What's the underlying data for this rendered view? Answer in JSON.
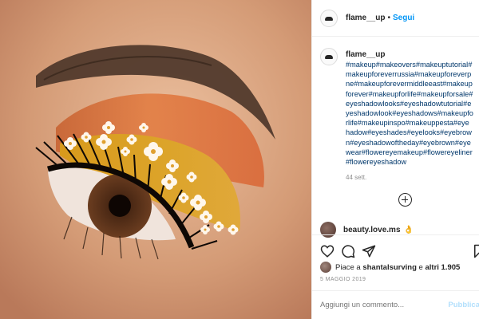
{
  "post": {
    "username": "flame__up",
    "separator": "•",
    "follow_label": "Segui"
  },
  "caption": {
    "username": "flame__up",
    "hashtag_lines": [
      "#makeup#makeovers#makeuptutorial#",
      "makeupforeverrussia#makeupforeverp",
      "ne#makeupforevermiddleeast#makeup",
      "forever#makeupforlife#makeupforsale#",
      "eyeshadowlooks#eyeshadowtutorial#e",
      "yeshadowlook#eyeshadows#makeupfo",
      "rlife#makeupinspo#makeuppesta#eye",
      "hadow#eyeshades#eyelooks#eyebrow",
      "n#eyeshadowoftheday#eyebrown#eye",
      "wear#flowereyemakeup#flowereyeliner",
      "#flowereyeshadow"
    ],
    "time_ago": "44 sett."
  },
  "comment": {
    "username": "beauty.love.ms",
    "emoji": "👌"
  },
  "likes": {
    "prefix": "Piace a",
    "user": "shantalsurving",
    "middle": "e",
    "others": "altri 1.905"
  },
  "date": "5 MAGGIO 2019",
  "comment_input": {
    "placeholder": "Aggiungi un commento..."
  },
  "publish_label": "Pubblica",
  "icons": [
    "heart-icon",
    "comment-icon",
    "share-icon",
    "bookmark-icon",
    "add-circle-icon"
  ],
  "colors": {
    "link": "#0095f6",
    "hashtag": "#00376b",
    "muted": "#8e8e8e",
    "eyeshadow_orange": "#e07a3c",
    "eyeshadow_gold": "#d9a520"
  }
}
